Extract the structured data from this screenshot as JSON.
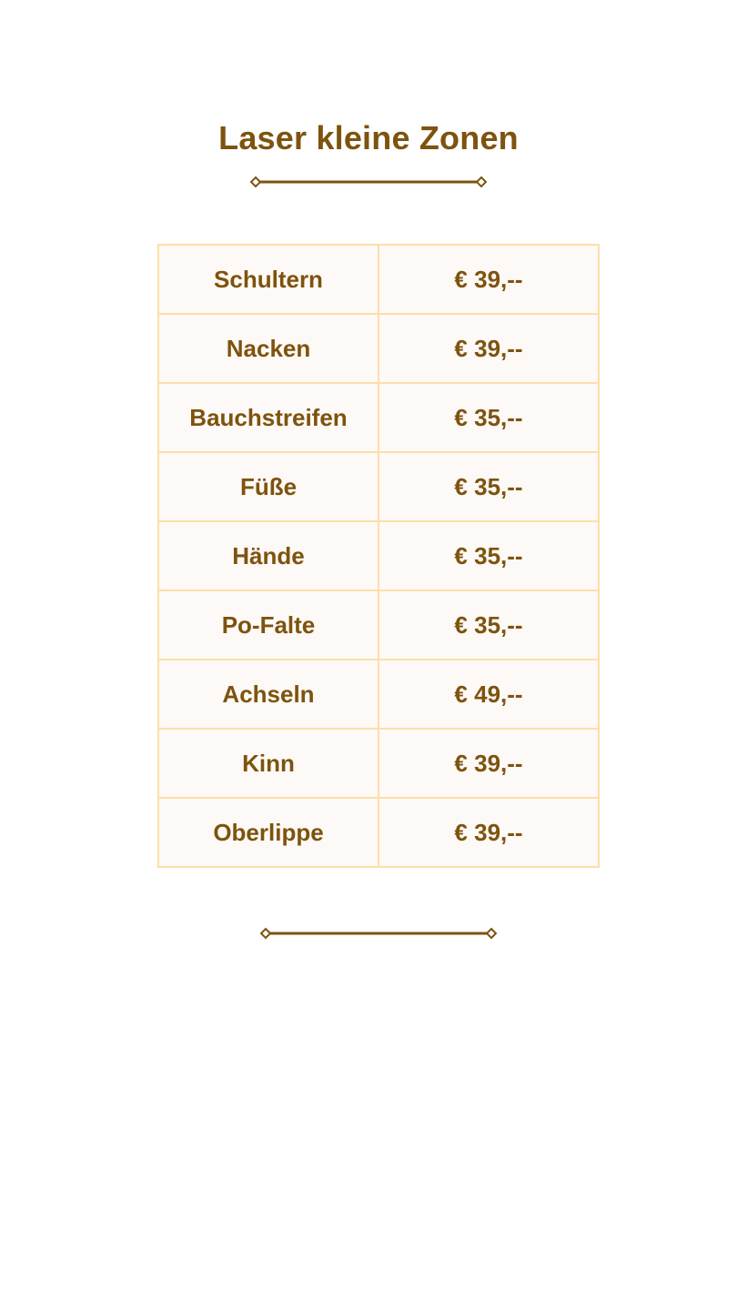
{
  "title": "Laser kleine Zonen",
  "colors": {
    "text": "#7d530e",
    "cell_border": "#fcdfa8",
    "cell_background": "#fdf9f6",
    "divider": "#7d530e"
  },
  "prices": [
    {
      "zone": "Schultern",
      "price": "€ 39,--"
    },
    {
      "zone": "Nacken",
      "price": "€ 39,--"
    },
    {
      "zone": "Bauchstreifen",
      "price": "€ 35,--"
    },
    {
      "zone": "Füße",
      "price": "€ 35,--"
    },
    {
      "zone": "Hände",
      "price": "€ 35,--"
    },
    {
      "zone": "Po-Falte",
      "price": "€ 35,--"
    },
    {
      "zone": "Achseln",
      "price": "€ 49,--"
    },
    {
      "zone": "Kinn",
      "price": "€ 39,--"
    },
    {
      "zone": "Oberlippe",
      "price": "€ 39,--"
    }
  ]
}
